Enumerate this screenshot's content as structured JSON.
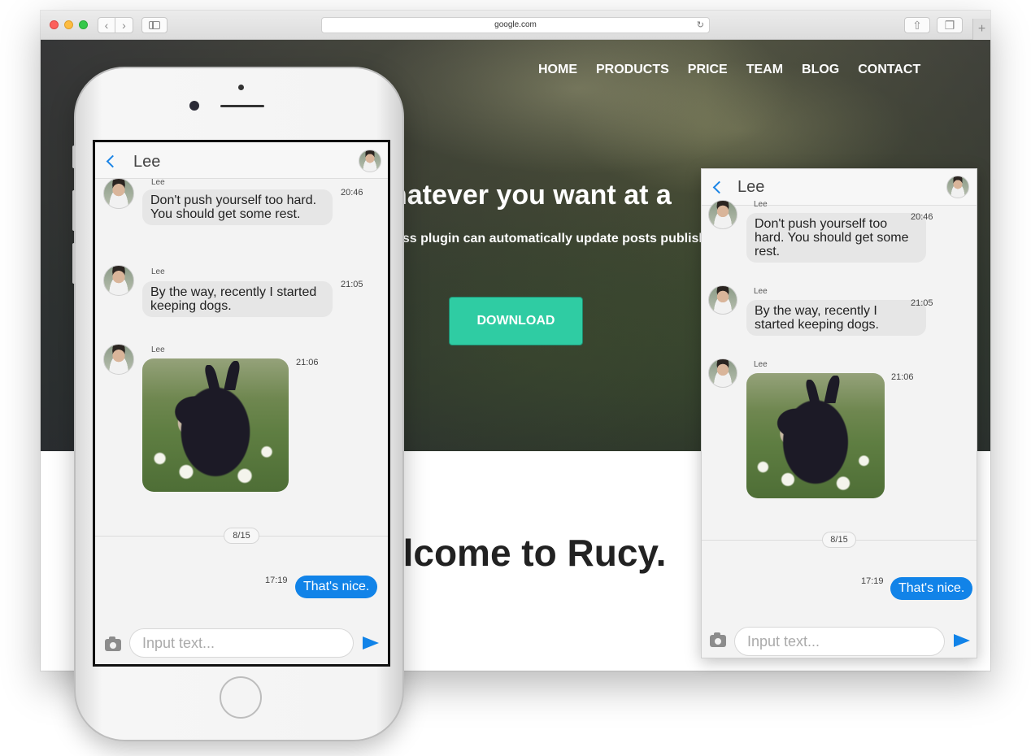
{
  "browser": {
    "url": "google.com"
  },
  "site": {
    "nav": [
      "HOME",
      "PRODUCTS",
      "PRICE",
      "TEAM",
      "BLOG",
      "CONTACT"
    ],
    "hero_title": "hatever you want at a",
    "hero_subtitle": "ess plugin can automatically update posts publish",
    "download_label": "DOWNLOAD",
    "welcome": "elcome to Rucy."
  },
  "chat": {
    "contact_name": "Lee",
    "messages": [
      {
        "sender": "Lee",
        "text": "Don't push yourself too hard. You should get some rest.",
        "time": "20:46"
      },
      {
        "sender": "Lee",
        "text": "By the way, recently I started keeping dogs.",
        "time": "21:05"
      },
      {
        "sender": "Lee",
        "type": "image",
        "time": "21:06"
      }
    ],
    "date_separator": "8/15",
    "my_message": {
      "text": "That's nice.",
      "time": "17:19"
    },
    "input_placeholder": "Input text..."
  },
  "colors": {
    "accent_blue": "#1183e8",
    "download_green": "#2fcca3"
  }
}
